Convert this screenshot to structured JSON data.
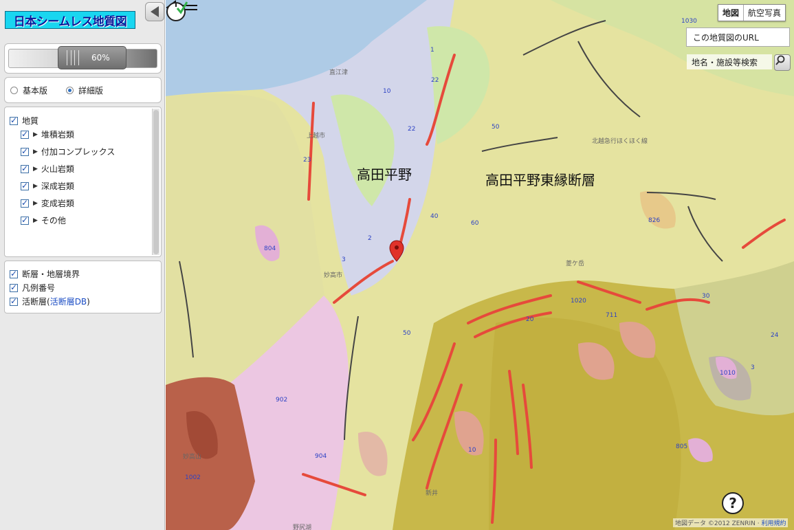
{
  "app": {
    "logo_text": "日本シームレス地質図"
  },
  "opacity": {
    "value_label": "60%",
    "value": 60
  },
  "version": {
    "options": [
      {
        "label": "基本版",
        "selected": false
      },
      {
        "label": "詳細版",
        "selected": true
      }
    ]
  },
  "layers": {
    "root": {
      "label": "地質",
      "checked": true
    },
    "items": [
      {
        "label": "堆積岩類",
        "checked": true
      },
      {
        "label": "付加コンプレックス",
        "checked": true
      },
      {
        "label": "火山岩類",
        "checked": true
      },
      {
        "label": "深成岩類",
        "checked": true
      },
      {
        "label": "変成岩類",
        "checked": true
      },
      {
        "label": "その他",
        "checked": true
      }
    ]
  },
  "overlays": {
    "fault_boundary": {
      "label": "断層・地層境界",
      "checked": true
    },
    "legend_number": {
      "label": "凡例番号",
      "checked": true
    },
    "active_fault_prefix": "活断層(",
    "active_fault_link": "活断層DB",
    "active_fault_suffix": ")",
    "active_fault_checked": true
  },
  "map_controls": {
    "map_type": [
      "地図",
      "航空写真"
    ],
    "url_button": "この地質図のURL",
    "search_placeholder": "地名・施設等検索",
    "help": "?",
    "attribution": "地図データ ©2012 ZENRIN",
    "terms": "利用規約"
  },
  "annotations": {
    "plain": "高田平野",
    "fault": "高田平野東縁断層"
  },
  "places": [
    "上越市",
    "妙高市",
    "妙高山",
    "菱ケ岳",
    "北越急行ほくほく線",
    "野尻湖",
    "新井",
    "直江津"
  ],
  "legend_numbers": [
    "1",
    "10",
    "22",
    "23",
    "50",
    "3",
    "2",
    "40",
    "60",
    "804",
    "902",
    "904",
    "1002",
    "1020",
    "711",
    "20",
    "30",
    "826",
    "3",
    "24",
    "1010",
    "805",
    "1030",
    "50",
    "10",
    "22"
  ],
  "colors": {
    "sea": "#aecbe6",
    "alluvium": "#d3d6ea",
    "terrace": "#cfe7a9",
    "sediment_yellow": "#e6e49e",
    "dark_olive": "#c8b84a",
    "volcanic_pink": "#ecc7e2",
    "volcanic_brown": "#b9614a",
    "salmon": "#e0a38f",
    "fault_red": "#e64a3b",
    "legend_blue": "#2d42c4"
  }
}
